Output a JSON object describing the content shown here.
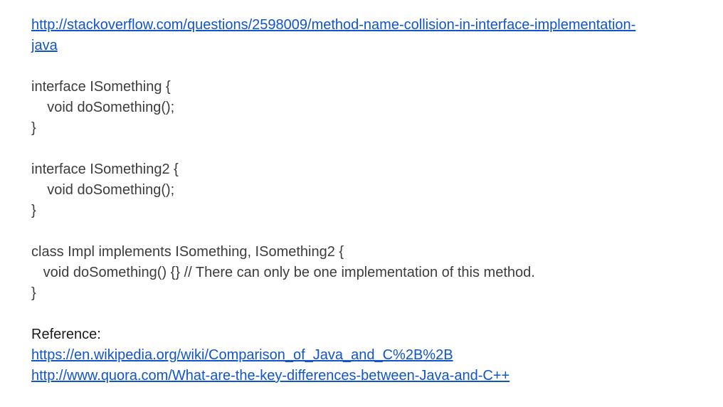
{
  "source_link": {
    "line1": "http://stackoverflow.com/questions/2598009/method-name-collision-in-interface-implementation-",
    "line2": "java"
  },
  "code": {
    "interface1": {
      "header": "interface ISomething {",
      "body": "    void doSomething();",
      "close": "}"
    },
    "interface2": {
      "header": "interface ISomething2 {",
      "body": "    void doSomething();",
      "close": "}"
    },
    "impl": {
      "header": "class Impl implements ISomething, ISomething2 {",
      "body": "   void doSomething() {} // There can only be one implementation of this method.",
      "close": "}"
    }
  },
  "reference": {
    "label": "Reference:",
    "links": [
      "https://en.wikipedia.org/wiki/Comparison_of_Java_and_C%2B%2B",
      "http://www.quora.com/What-are-the-key-differences-between-Java-and-C++"
    ]
  }
}
